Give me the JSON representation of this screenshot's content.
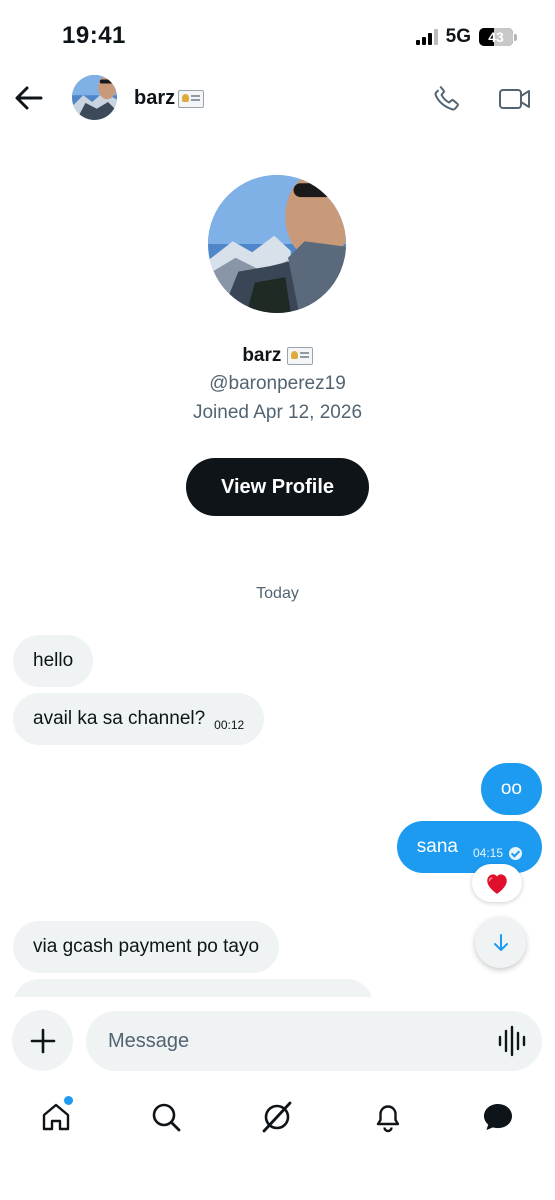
{
  "status_bar": {
    "time": "19:41",
    "network": "5G",
    "battery": "43",
    "battery_level": 0.43
  },
  "header": {
    "name": "barz",
    "name_badge_icon": "id-card-icon"
  },
  "profile": {
    "name": "barz",
    "handle": "@baronperez19",
    "joined": "Joined Apr 12, 2026",
    "view_profile_label": "View Profile"
  },
  "date_separator": "Today",
  "messages": [
    {
      "direction": "incoming",
      "text": "hello",
      "time": ""
    },
    {
      "direction": "incoming",
      "text": "avail ka sa channel?",
      "time": "00:12"
    },
    {
      "direction": "outgoing",
      "text": "oo",
      "time": ""
    },
    {
      "direction": "outgoing",
      "text": "sana",
      "time": "04:15",
      "read": true,
      "reaction": "heart"
    },
    {
      "direction": "incoming",
      "text": "via gcash payment po tayo",
      "time": ""
    }
  ],
  "composer": {
    "placeholder": "Message"
  },
  "nav": {
    "items": [
      "home-icon",
      "search-icon",
      "grok-icon",
      "notifications-icon",
      "messages-icon"
    ],
    "home_has_badge": true
  },
  "colors": {
    "accent": "#1d9bf0",
    "incoming_bubble": "#eff3f4",
    "primary_button": "#0f1419",
    "secondary_text": "#536471"
  }
}
